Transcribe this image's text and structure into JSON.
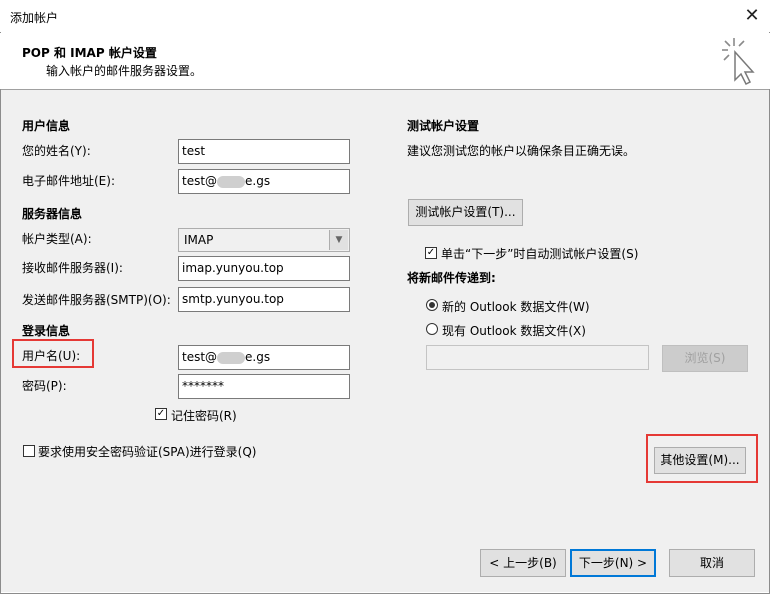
{
  "window": {
    "title": "添加帐户"
  },
  "header": {
    "title": "POP 和 IMAP 帐户设置",
    "subtitle": "输入帐户的邮件服务器设置。"
  },
  "user_info": {
    "heading": "用户信息",
    "name_label": "您的姓名(Y):",
    "name_value": "test",
    "email_label": "电子邮件地址(E):",
    "email_value_prefix": "test@",
    "email_value_suffix": "e.gs"
  },
  "server_info": {
    "heading": "服务器信息",
    "account_type_label": "帐户类型(A):",
    "account_type_value": "IMAP",
    "incoming_label": "接收邮件服务器(I):",
    "incoming_value": "imap.yunyou.top",
    "outgoing_label": "发送邮件服务器(SMTP)(O):",
    "outgoing_value": "smtp.yunyou.top"
  },
  "login_info": {
    "heading": "登录信息",
    "username_label": "用户名(U):",
    "username_prefix": "test@",
    "username_suffix": "e.gs",
    "password_label": "密码(P):",
    "password_value": "*******",
    "remember_label": "记住密码(R)",
    "remember_checked": true,
    "spa_label": "要求使用安全密码验证(SPA)进行登录(Q)",
    "spa_checked": false
  },
  "test_settings": {
    "heading": "测试帐户设置",
    "description": "建议您测试您的帐户以确保条目正确无误。",
    "test_button": "测试帐户设置(T)...",
    "auto_test_label": "单击“下一步”时自动测试帐户设置(S)",
    "auto_test_checked": true
  },
  "deliver": {
    "heading": "将新邮件传递到:",
    "option_new": "新的 Outlook 数据文件(W)",
    "option_existing": "现有 Outlook 数据文件(X)",
    "selected": "new",
    "browse_button": "浏览(S)"
  },
  "more_settings_button": "其他设置(M)...",
  "footer": {
    "back_button": "< 上一步(B)",
    "next_button": "下一步(N) >",
    "cancel_button": "取消"
  },
  "colors": {
    "highlight": "#e53935",
    "panel": "#f0f0f0",
    "focus_border": "#0078d7"
  }
}
